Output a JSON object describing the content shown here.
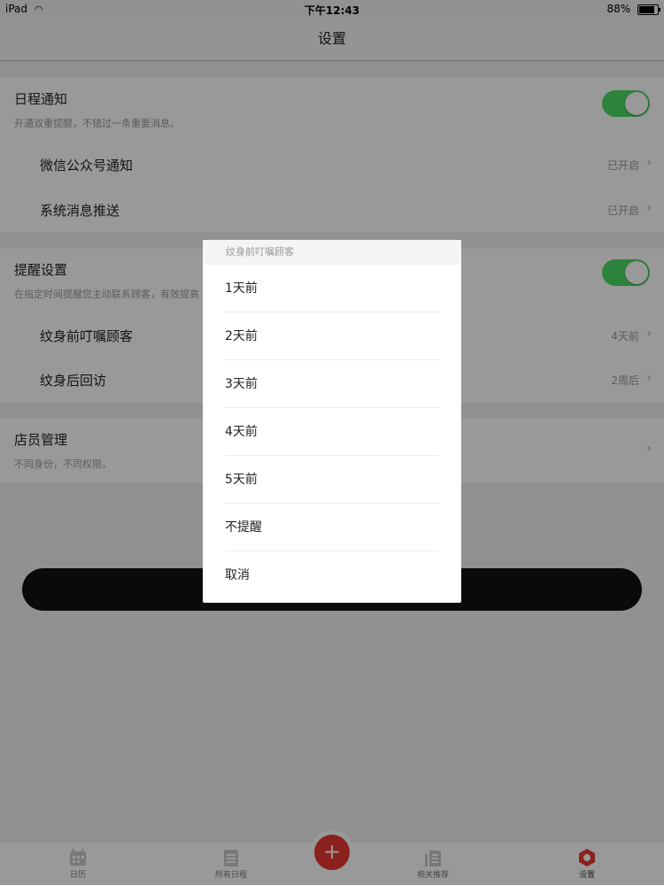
{
  "status": {
    "carrier": "iPad",
    "time": "下午12:43",
    "battery": "88%",
    "battery_level": 0.88
  },
  "nav": {
    "title": "设置"
  },
  "schedule_notify": {
    "title": "日程通知",
    "desc": "开通双重提醒，不错过一条重要消息。",
    "toggle_on": true,
    "items": [
      {
        "label": "微信公众号通知",
        "value": "已开启"
      },
      {
        "label": "系统消息推送",
        "value": "已开启"
      }
    ]
  },
  "reminder": {
    "title": "提醒设置",
    "desc": "在指定时间提醒您主动联系顾客，有效提高",
    "toggle_on": true,
    "items": [
      {
        "label": "纹身前叮嘱顾客",
        "value": "4天前"
      },
      {
        "label": "纹身后回访",
        "value": "2周后"
      }
    ]
  },
  "staff": {
    "title": "店员管理",
    "desc": "不同身份，不同权限。"
  },
  "action_sheet": {
    "title": "纹身前叮嘱顾客",
    "options": [
      "1天前",
      "2天前",
      "3天前",
      "4天前",
      "5天前",
      "不提醒"
    ],
    "cancel": "取消"
  },
  "tabbar": {
    "items": [
      {
        "label": "日历",
        "icon": "calendar-icon"
      },
      {
        "label": "所有日程",
        "icon": "list-icon"
      },
      {
        "label": "相关推荐",
        "icon": "recommend-icon"
      },
      {
        "label": "设置",
        "icon": "settings-icon"
      }
    ],
    "fab": "+",
    "active_color": "#e8372f",
    "toggle_color": "#4cd964"
  }
}
